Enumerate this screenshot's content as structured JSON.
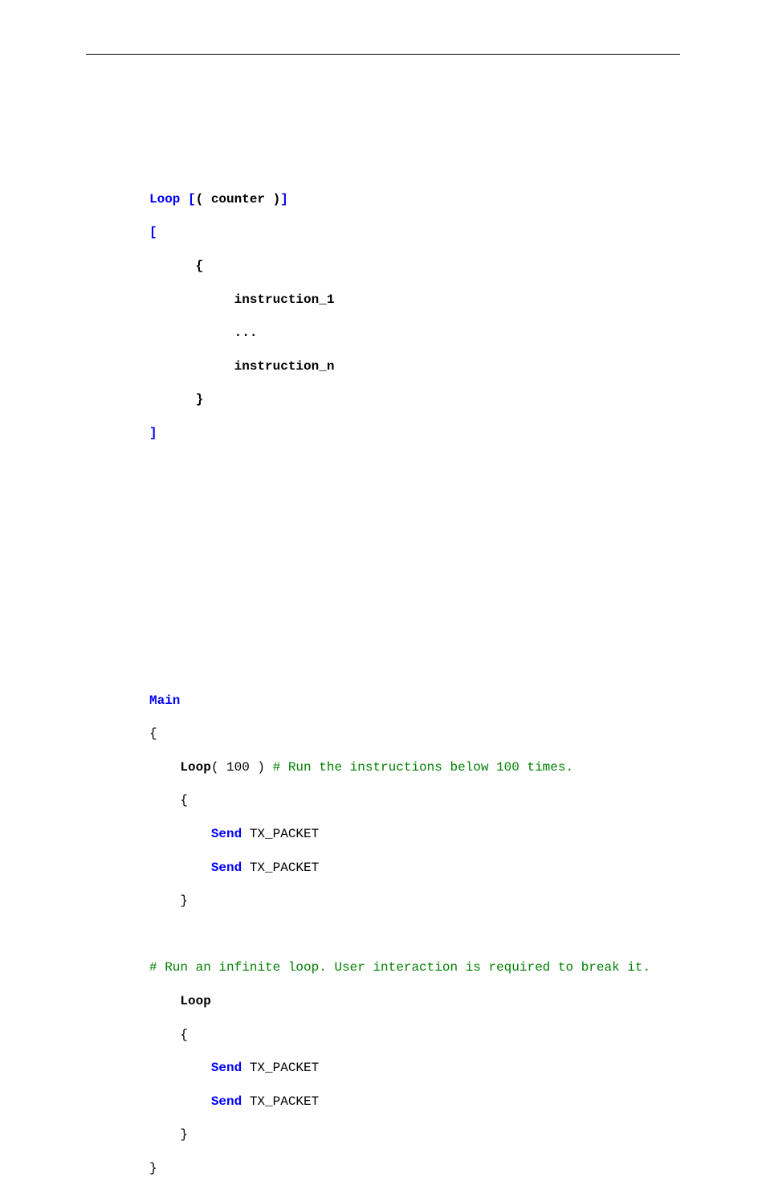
{
  "syntax": {
    "l1a": "Loop [",
    "l1b": "( ",
    "l1c": "counter ",
    "l1d": ")",
    "l1e": "]",
    "l2": "[",
    "l3": "      {",
    "l4": "           instruction_1",
    "l5": "           ...",
    "l6": "           instruction_n",
    "l7": "      }",
    "l8": "]"
  },
  "example": {
    "e1": "Main",
    "e2": "{",
    "e3a": "    ",
    "e3b": "Loop",
    "e3c": "( 100 ) ",
    "e3d": "# Run the instructions below 100 times.",
    "e4": "    {",
    "e5a": "        ",
    "e5b": "Send",
    "e5c": " TX_PACKET",
    "e6a": "        ",
    "e6b": "Send",
    "e6c": " TX_PACKET",
    "e7": "    }",
    "e8": "# Run an infinite loop. User interaction is required to break it.",
    "e9a": "    ",
    "e9b": "Loop",
    "e10": "    {",
    "e11a": "        ",
    "e11b": "Send",
    "e11c": " TX_PACKET",
    "e12a": "        ",
    "e12b": "Send",
    "e12c": " TX_PACKET",
    "e13": "    }",
    "e14": "}"
  }
}
